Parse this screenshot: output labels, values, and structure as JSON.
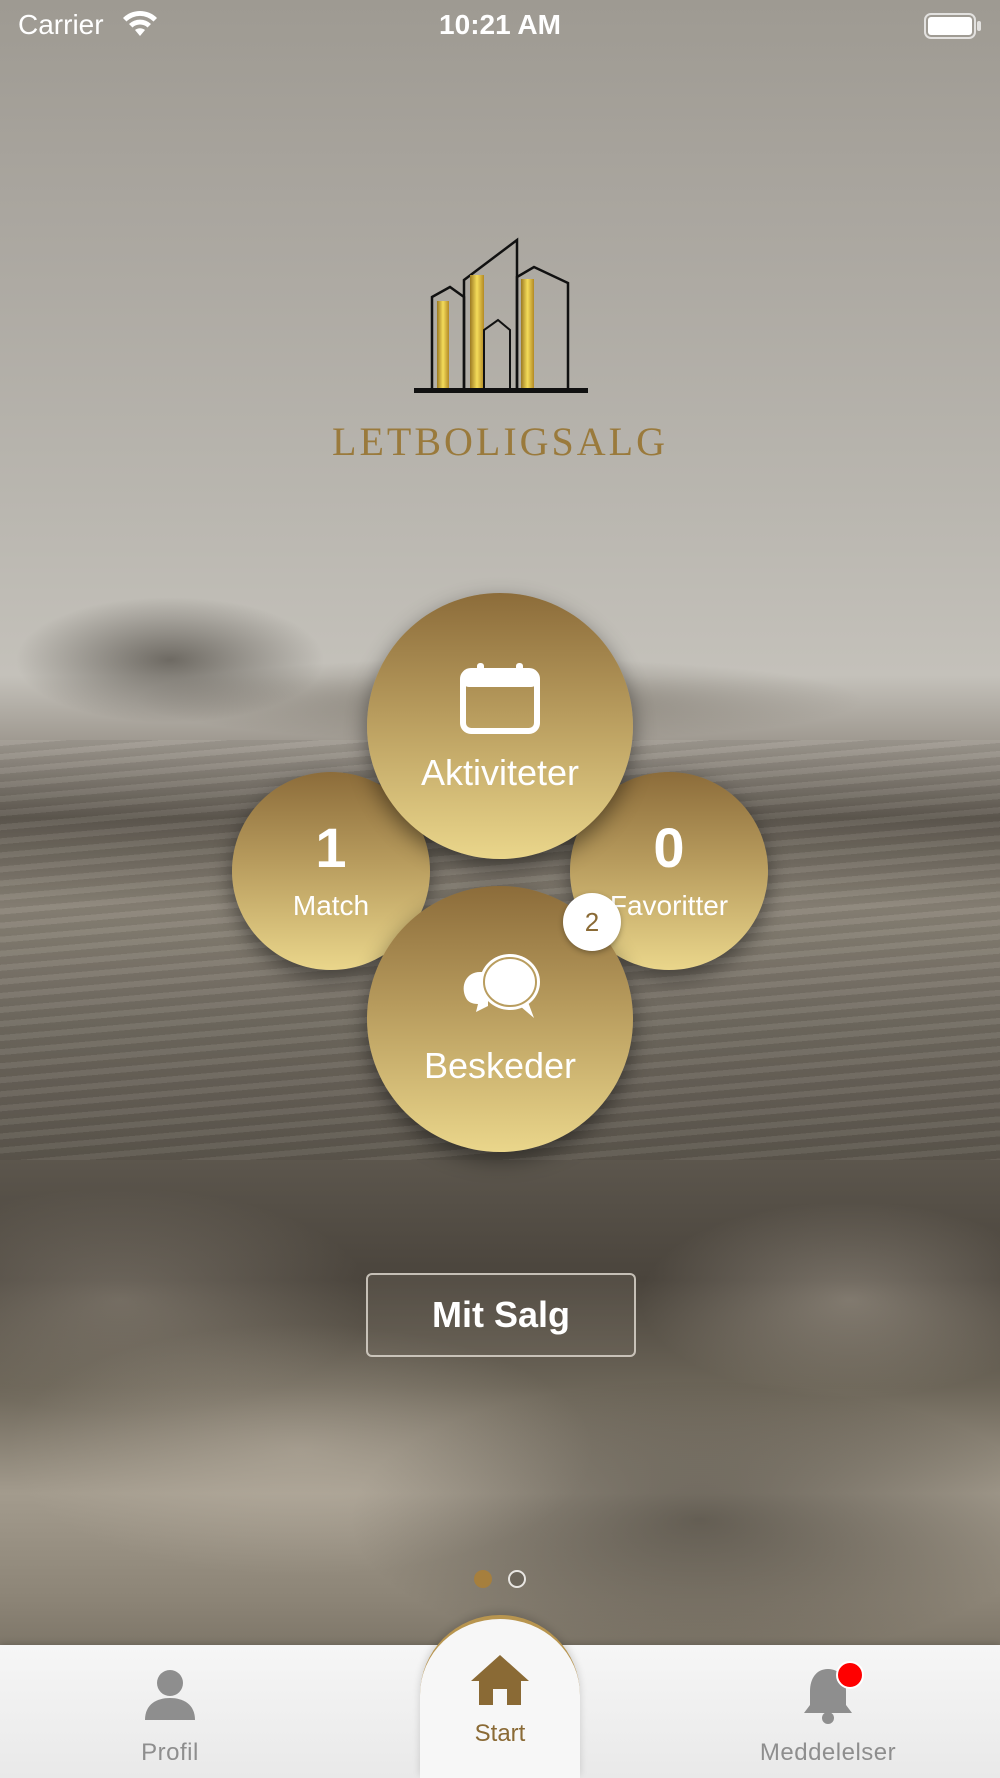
{
  "status_bar": {
    "carrier": "Carrier",
    "time": "10:21 AM",
    "wifi_icon": "wifi-icon",
    "battery_icon": "battery-icon"
  },
  "brand": {
    "name": "LETBOLIGSALG",
    "logo_icon": "buildings-logo"
  },
  "dashboard": {
    "activities": {
      "label": "Aktiviteter",
      "icon": "calendar-icon"
    },
    "match": {
      "count": "1",
      "label": "Match"
    },
    "favorites": {
      "count": "0",
      "label": "Favoritter"
    },
    "messages": {
      "label": "Beskeder",
      "icon": "chat-bubbles-icon",
      "badge": "2"
    }
  },
  "my_sales_button": "Mit Salg",
  "pager": {
    "pages": 2,
    "current": 1
  },
  "tabbar": {
    "profile": {
      "label": "Profil",
      "icon": "person-icon"
    },
    "start": {
      "label": "Start",
      "icon": "home-icon"
    },
    "notifications": {
      "label": "Meddelelser",
      "icon": "bell-icon"
    }
  },
  "colors": {
    "gold_dark": "#8c6c3a",
    "gold_light": "#ead68b",
    "accent": "#a67f3d",
    "notification_dot": "#ff0000"
  }
}
